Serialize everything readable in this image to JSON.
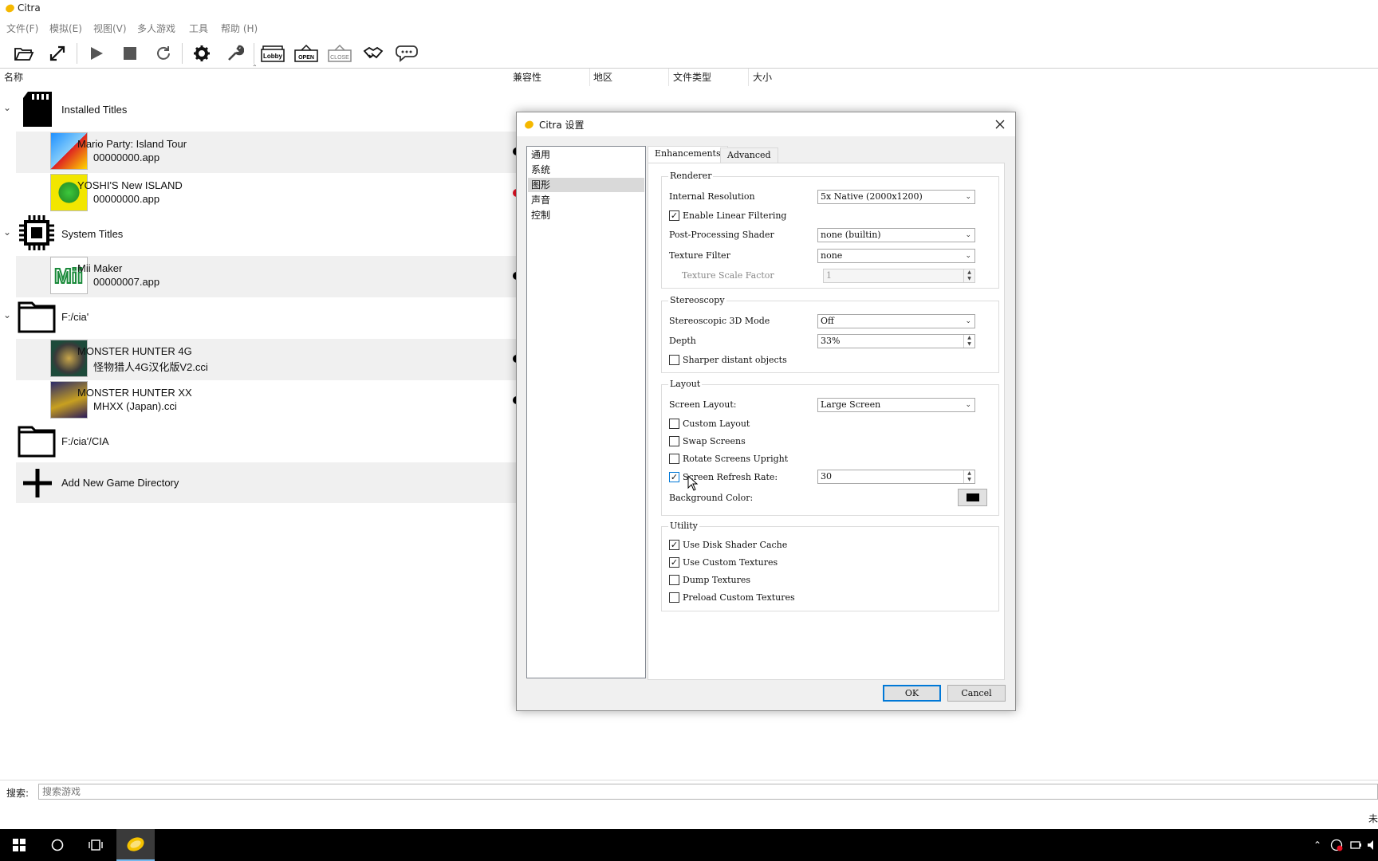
{
  "window": {
    "title": "Citra"
  },
  "menu": [
    "文件(F)",
    "模拟(E)",
    "视图(V)",
    "多人游戏",
    "工具",
    "帮助 (H)"
  ],
  "toolbar": {
    "buttons": [
      {
        "name": "open-folder-icon"
      },
      {
        "name": "fullscreen-icon"
      },
      {
        "name": "play-icon"
      },
      {
        "name": "stop-icon"
      },
      {
        "name": "restart-icon"
      },
      {
        "name": "gear-icon"
      },
      {
        "name": "wrench-icon"
      },
      {
        "name": "lobby-icon",
        "label": "Lobby"
      },
      {
        "name": "open-room-icon",
        "label": "OPEN"
      },
      {
        "name": "close-room-icon",
        "label": "CLOSE"
      },
      {
        "name": "handshake-icon"
      },
      {
        "name": "chat-icon"
      }
    ]
  },
  "columns": [
    "名称",
    "兼容性",
    "地区",
    "文件类型",
    "大小"
  ],
  "game_list": {
    "groups": [
      {
        "label": "Installed Titles",
        "icon": "sd-card-icon"
      },
      {
        "label": "System Titles",
        "icon": "chip-icon"
      },
      {
        "label": "F:/cia'",
        "icon": "folder-icon"
      },
      {
        "label": "F:/cia'/CIA",
        "icon": "folder-icon"
      },
      {
        "label": "Add New Game Directory",
        "icon": "plus-icon"
      }
    ],
    "games": [
      {
        "name": "Mario Party: Island Tour",
        "file": "00000000.app",
        "compat": "#000000"
      },
      {
        "name": "YOSHI'S New ISLAND",
        "file": "00000000.app",
        "compat": "#e81123"
      },
      {
        "name": "Mii Maker",
        "file": "00000007.app",
        "compat": "#000000"
      },
      {
        "name": "MONSTER HUNTER 4G",
        "file": "怪物猎人4G汉化版V2.cci",
        "compat": "#000000"
      },
      {
        "name": "MONSTER HUNTER XX",
        "file": "MHXX (Japan).cci",
        "compat": "#000000"
      }
    ]
  },
  "search": {
    "label": "搜索:",
    "placeholder": "搜索游戏"
  },
  "status": {
    "truncated": "未"
  },
  "dialog": {
    "title": "Citra 设置",
    "categories": [
      "通用",
      "系统",
      "图形",
      "声音",
      "控制"
    ],
    "selected_category": "图形",
    "tabs": [
      "Enhancements",
      "Advanced"
    ],
    "active_tab": "Enhancements",
    "renderer": {
      "title": "Renderer",
      "internal_resolution_label": "Internal Resolution",
      "internal_resolution_value": "5x Native (2000x1200)",
      "linear_filtering_label": "Enable Linear Filtering",
      "linear_filtering_checked": true,
      "post_processing_label": "Post-Processing Shader",
      "post_processing_value": "none (builtin)",
      "texture_filter_label": "Texture Filter",
      "texture_filter_value": "none",
      "texture_scale_label": "Texture Scale Factor",
      "texture_scale_value": "1"
    },
    "stereoscopy": {
      "title": "Stereoscopy",
      "mode_label": "Stereoscopic 3D Mode",
      "mode_value": "Off",
      "depth_label": "Depth",
      "depth_value": "33%",
      "sharper_label": "Sharper distant objects",
      "sharper_checked": false
    },
    "layout": {
      "title": "Layout",
      "screen_layout_label": "Screen Layout:",
      "screen_layout_value": "Large Screen",
      "custom_layout_label": "Custom Layout",
      "swap_screens_label": "Swap Screens",
      "rotate_label": "Rotate Screens Upright",
      "refresh_rate_label": "Screen Refresh Rate:",
      "refresh_rate_checked": true,
      "refresh_rate_value": "30",
      "bg_color_label": "Background Color:",
      "bg_color": "#000000"
    },
    "utility": {
      "title": "Utility",
      "disk_cache_label": "Use Disk Shader Cache",
      "custom_textures_label": "Use Custom Textures",
      "dump_textures_label": "Dump Textures",
      "preload_label": "Preload Custom Textures"
    },
    "ok_label": "OK",
    "cancel_label": "Cancel"
  },
  "colors": {
    "accent": "#0078d7",
    "taskbar": "#000000",
    "row_alt": "#f0f0f0"
  }
}
